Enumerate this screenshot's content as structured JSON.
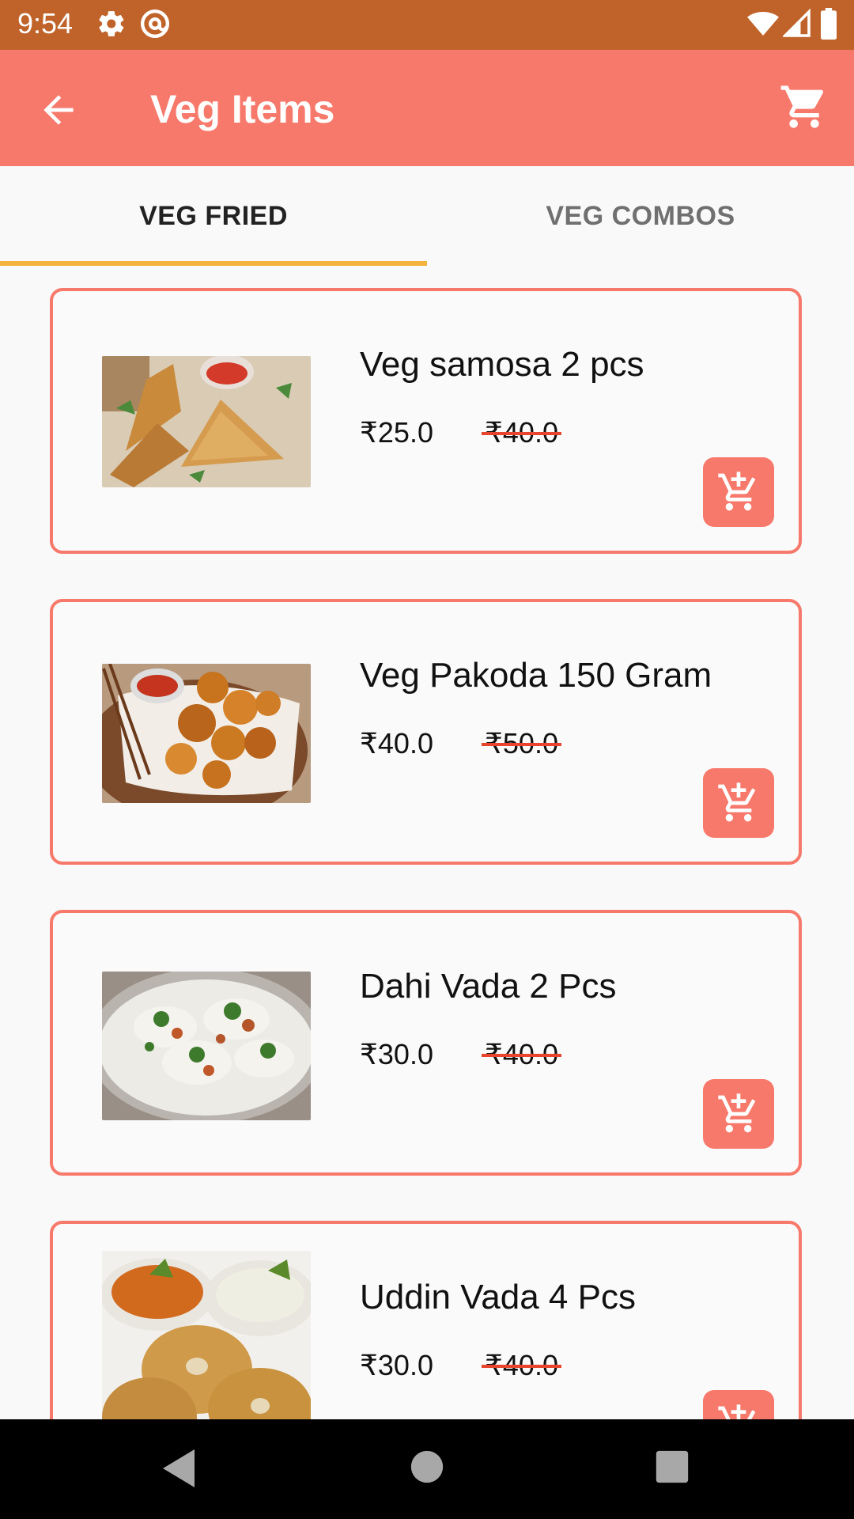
{
  "status_bar": {
    "time": "9:54",
    "icons": [
      "settings-icon",
      "at-sign-icon",
      "wifi-icon",
      "signal-icon",
      "battery-icon"
    ]
  },
  "app_bar": {
    "title": "Veg Items",
    "back_icon": "arrow-back-icon",
    "cart_icon": "shopping-cart-icon",
    "color": "#f7796b"
  },
  "tabs": [
    {
      "label": "VEG FRIED",
      "active": true
    },
    {
      "label": "VEG COMBOS",
      "active": false
    }
  ],
  "products": [
    {
      "name": "Veg samosa 2 pcs",
      "price": "₹25.0",
      "old_price": "₹40.0",
      "image": "samosa-image",
      "button_icon": "add-to-cart-icon"
    },
    {
      "name": "Veg Pakoda 150 Gram",
      "price": "₹40.0",
      "old_price": "₹50.0",
      "image": "pakoda-image",
      "button_icon": "add-to-cart-icon"
    },
    {
      "name": "Dahi Vada 2 Pcs",
      "price": "₹30.0",
      "old_price": "₹40.0",
      "image": "dahi-vada-image",
      "button_icon": "add-to-cart-icon"
    },
    {
      "name": "Uddin Vada 4 Pcs",
      "price": "₹30.0",
      "old_price": "₹40.0",
      "image": "uddin-vada-image",
      "button_icon": "add-to-cart-icon"
    }
  ],
  "nav_bar": {
    "icons": [
      "back-triangle-icon",
      "home-circle-icon",
      "recents-square-icon"
    ]
  },
  "colors": {
    "status_bar": "#c0632a",
    "accent": "#f7796b",
    "tab_indicator": "#f3b33d",
    "strike": "#e8452e"
  }
}
